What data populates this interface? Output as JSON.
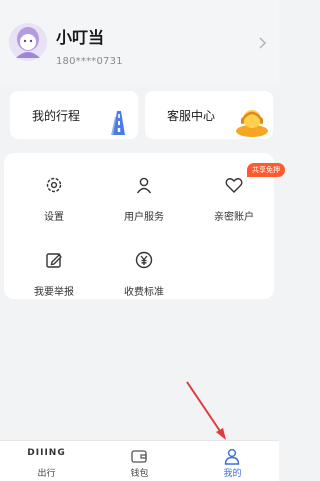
{
  "profile": {
    "name": "小叮当",
    "phone": "180****0731"
  },
  "quick_cards": [
    {
      "label": "我的行程",
      "icon": "road-icon"
    },
    {
      "label": "客服中心",
      "icon": "customer-service-icon"
    }
  ],
  "services": {
    "items": [
      {
        "label": "设置",
        "icon": "gear-icon"
      },
      {
        "label": "用户服务",
        "icon": "user-icon"
      },
      {
        "label": "亲密账户",
        "icon": "heart-icon",
        "badge": "共享免押"
      },
      {
        "label": "我要举报",
        "icon": "edit-icon"
      },
      {
        "label": "收费标准",
        "icon": "yuan-icon"
      }
    ]
  },
  "tabbar": {
    "tabs": [
      {
        "logo": "DIIING",
        "label": "出行"
      },
      {
        "label": "钱包",
        "icon": "wallet-icon"
      },
      {
        "label": "我的",
        "icon": "person-icon",
        "active": true
      }
    ]
  },
  "colors": {
    "accent": "#3b6fd8",
    "badge": "#ff5a2f",
    "annotation_arrow": "#e03a3a"
  }
}
